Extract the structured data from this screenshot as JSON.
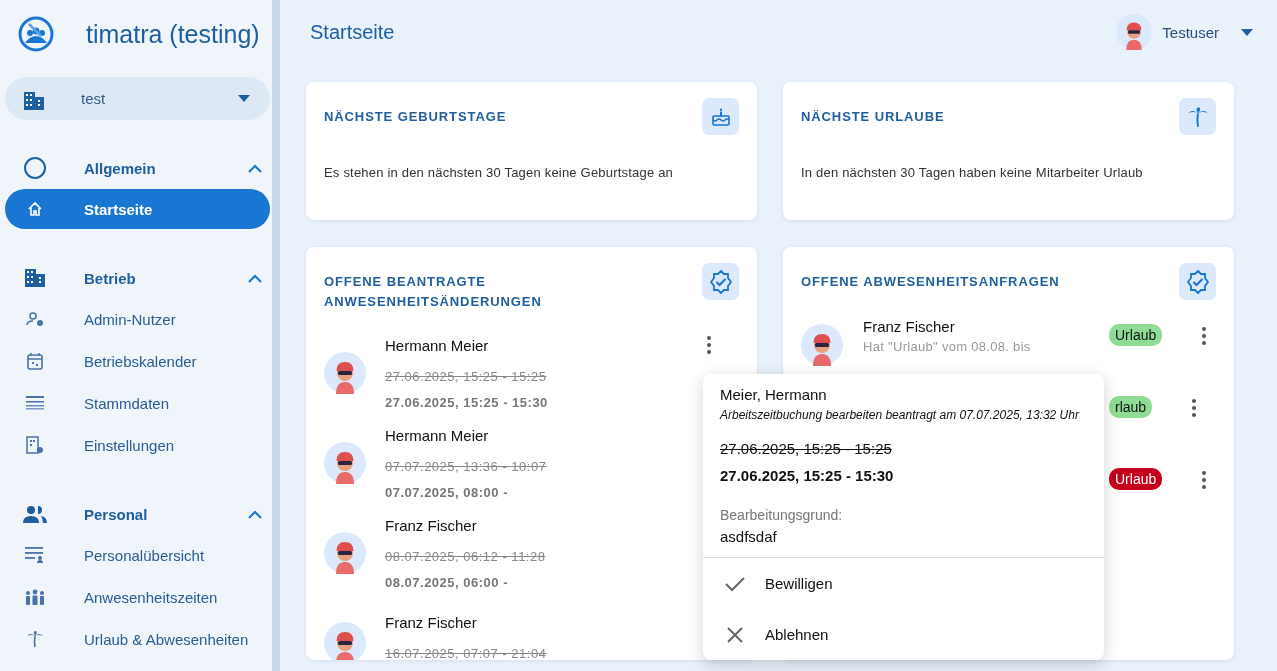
{
  "app": {
    "title": "timatra (testing)"
  },
  "org_select": {
    "value": "test"
  },
  "sidebar": {
    "sections": [
      {
        "label": "Allgemein",
        "expanded": true,
        "items": [
          {
            "label": "Startseite",
            "selected": true
          }
        ]
      },
      {
        "label": "Betrieb",
        "expanded": true,
        "items": [
          {
            "label": "Admin-Nutzer",
            "selected": false
          },
          {
            "label": "Betriebskalender",
            "selected": false
          },
          {
            "label": "Stammdaten",
            "selected": false
          },
          {
            "label": "Einstellungen",
            "selected": false
          }
        ]
      },
      {
        "label": "Personal",
        "expanded": true,
        "items": [
          {
            "label": "Personalübersicht",
            "selected": false
          },
          {
            "label": "Anwesenheitszeiten",
            "selected": false
          },
          {
            "label": "Urlaub & Abwesenheiten",
            "selected": false
          }
        ]
      }
    ]
  },
  "header": {
    "title": "Startseite",
    "user": "Testuser"
  },
  "info_cards": [
    {
      "title": "NÄCHSTE GEBURTSTAGE",
      "message": "Es stehen in den nächsten 30 Tagen keine Geburtstage an"
    },
    {
      "title": "NÄCHSTE URLAUBE",
      "message": "In den nächsten 30 Tagen haben keine Mitarbeiter Urlaub"
    }
  ],
  "changes_card": {
    "title": "OFFENE BEANTRAGTE ANWESENHEITSÄNDERUNGEN",
    "rows": [
      {
        "name": "Hermann Meier",
        "old": "27.06.2025, 15:25 - 15:25",
        "new": "27.06.2025, 15:25 - 15:30"
      },
      {
        "name": "Hermann Meier",
        "old": "07.07.2025, 13:36 - 10:07",
        "new": "07.07.2025, 08:00 -"
      },
      {
        "name": "Franz Fischer",
        "old": "08.07.2025, 06:12 - 11:28",
        "new": "08.07.2025, 06:00 -"
      },
      {
        "name": "Franz Fischer",
        "old": "16.07.2025, 07:07 - 21:04"
      }
    ]
  },
  "absence_card": {
    "title": "OFFENE ABWESENHEITSANFRAGEN",
    "rows": [
      {
        "name": "Franz Fischer",
        "text": "Hat \"Urlaub\" vom 08.08. bis",
        "badge": "Urlaub",
        "color": "#8fdc95"
      },
      {
        "badge": "rlaub",
        "color": "#8fdc95"
      },
      {
        "badge": "Urlaub",
        "color": "#c4001c"
      }
    ]
  },
  "popup": {
    "title": "Meier, Hermann",
    "subtitle": "Arbeitszeitbuchung bearbeiten beantragt am 07.07.2025, 13:32 Uhr",
    "old": "27.06.2025, 15:25 - 15:25",
    "new": "27.06.2025, 15:25 - 15:30",
    "reason_label": "Bearbeitungsgrund:",
    "reason": "asdfsdaf",
    "actions": [
      "Bewilligen",
      "Ablehnen"
    ]
  }
}
